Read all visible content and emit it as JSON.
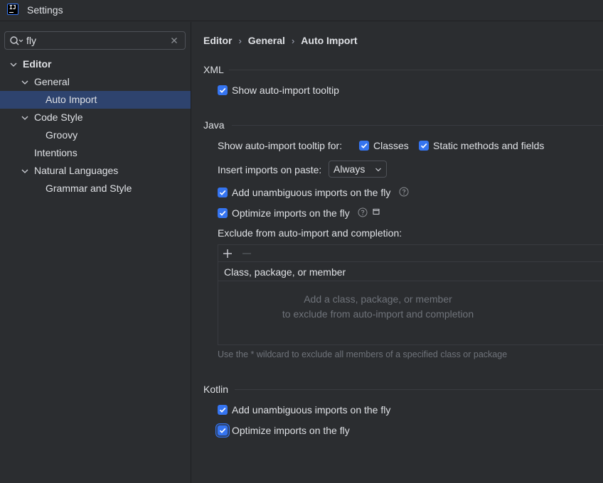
{
  "window": {
    "title": "Settings",
    "app_icon_text": "IJ"
  },
  "search": {
    "value": "fly",
    "placeholder": ""
  },
  "tree": {
    "items": [
      {
        "label": "Editor"
      },
      {
        "label": "General"
      },
      {
        "label": "Auto Import"
      },
      {
        "label": "Code Style"
      },
      {
        "label": "Groovy"
      },
      {
        "label": "Intentions"
      },
      {
        "label": "Natural Languages"
      },
      {
        "label": "Grammar and Style"
      }
    ]
  },
  "breadcrumb": [
    "Editor",
    "General",
    "Auto Import"
  ],
  "breadcrumb_sep": "›",
  "xml": {
    "title": "XML",
    "show_tooltip": {
      "label": "Show auto-import tooltip",
      "checked": true
    }
  },
  "java": {
    "title": "Java",
    "tooltip_for_label": "Show auto-import tooltip for:",
    "classes": {
      "label": "Classes",
      "checked": true
    },
    "static_methods": {
      "label": "Static methods and fields",
      "checked": true
    },
    "insert_on_paste_label": "Insert imports on paste:",
    "insert_on_paste_value": "Always",
    "add_unambiguous": {
      "label": "Add unambiguous imports on the fly",
      "checked": true
    },
    "optimize": {
      "label": "Optimize imports on the fly",
      "checked": true
    },
    "exclude_label": "Exclude from auto-import and completion:",
    "table_header": "Class, package, or member",
    "empty_line1": "Add a class, package, or member",
    "empty_line2": "to exclude from auto-import and completion",
    "wildcard_hint": "Use the * wildcard to exclude all members of a specified class or package"
  },
  "kotlin": {
    "title": "Kotlin",
    "add_unambiguous": {
      "label": "Add unambiguous imports on the fly",
      "checked": true
    },
    "optimize": {
      "label": "Optimize imports on the fly",
      "checked": true
    }
  },
  "colors": {
    "background": "#2b2d30",
    "accent": "#3574f0",
    "selection": "#2e436e",
    "muted_text": "#6f737a"
  }
}
